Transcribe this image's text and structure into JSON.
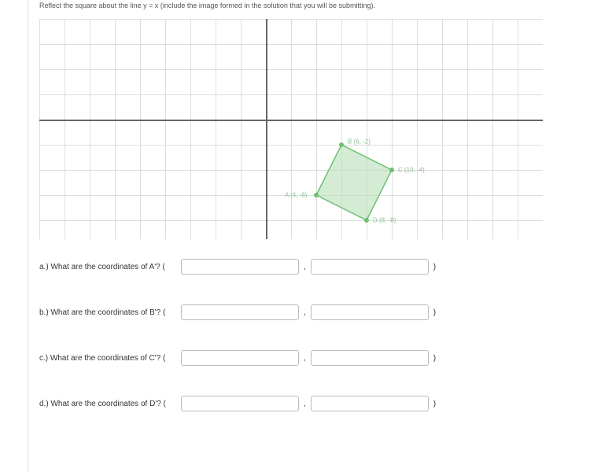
{
  "instruction": "Reflect the square about the line y = x (include the image formed in the solution that you will be submitting).",
  "points": {
    "A": {
      "label": "A (4, -6)",
      "x": 4,
      "y": -6
    },
    "B": {
      "label": "B (6, -2)",
      "x": 6,
      "y": -2
    },
    "C": {
      "label": "C (10, -4)",
      "x": 10,
      "y": -4
    },
    "D": {
      "label": "D (8, -8)",
      "x": 8,
      "y": -8
    }
  },
  "questions": {
    "a": {
      "label": "a.) What are the coordinates of A'? (",
      "close": ")"
    },
    "b": {
      "label": "b.) What are the coordinates of B'? (",
      "close": ")"
    },
    "c": {
      "label": "c.) What are the coordinates of C'? (",
      "close": ")"
    },
    "d": {
      "label": "d.) What are the coordinates of D'? (",
      "close": ")"
    }
  }
}
